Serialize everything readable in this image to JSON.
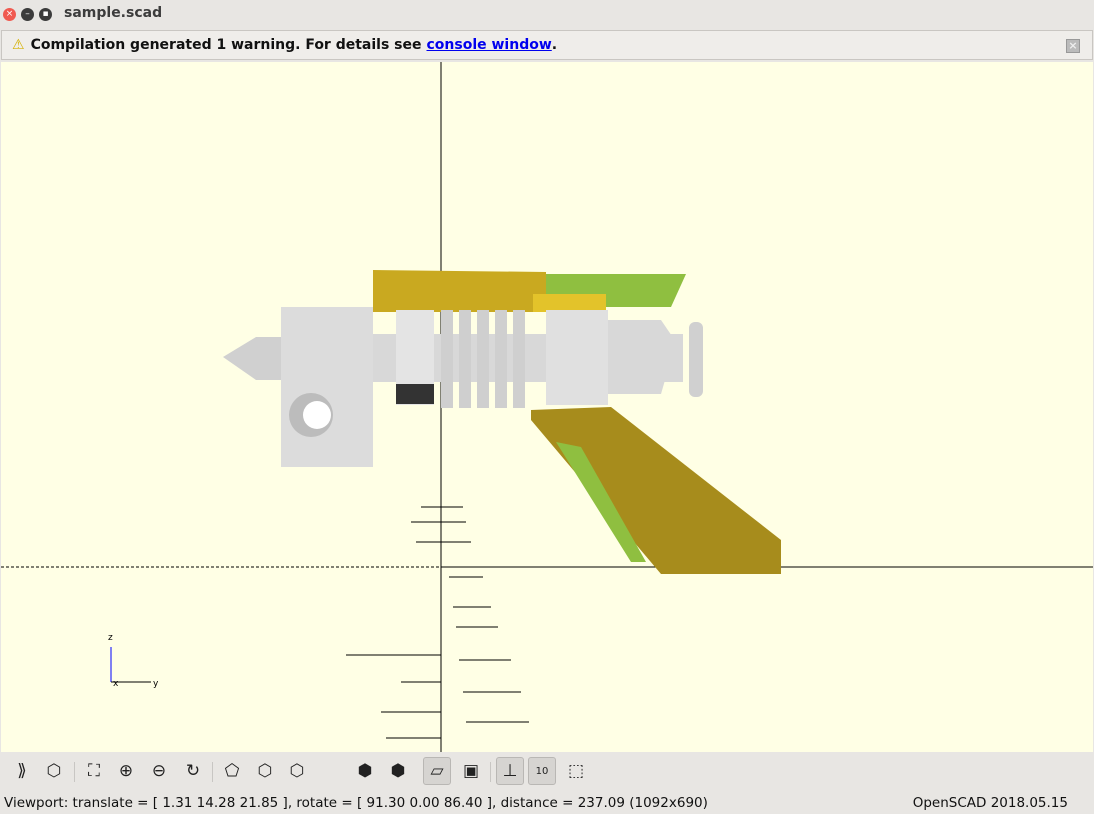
{
  "window": {
    "title": "sample.scad"
  },
  "warning": {
    "text": "Compilation generated 1 warning. For details see",
    "link": "console window",
    "suffix": "."
  },
  "axes_labels": {
    "z": "z",
    "x": "x",
    "y": "y"
  },
  "toolbar": {
    "buttons": [
      "preview",
      "render",
      "view-all",
      "zoom-in",
      "zoom-out",
      "reset-view",
      "view-right",
      "view-top",
      "view-bottom",
      "view-left",
      "view-front",
      "perspective",
      "orthogonal",
      "show-axes",
      "show-scale-markers",
      "show-edges"
    ],
    "scale_label": "10"
  },
  "status": {
    "viewport": "Viewport: translate = [ 1.31 14.28 21.85 ], rotate = [ 91.30 0.00 86.40 ], distance = 237.09 (1092x690)",
    "version": "OpenSCAD 2018.05.15"
  },
  "colors": {
    "background": "#ffffe5",
    "gold": "#c9a920",
    "steel": "#d9d9d9",
    "green": "#8fbf40"
  }
}
